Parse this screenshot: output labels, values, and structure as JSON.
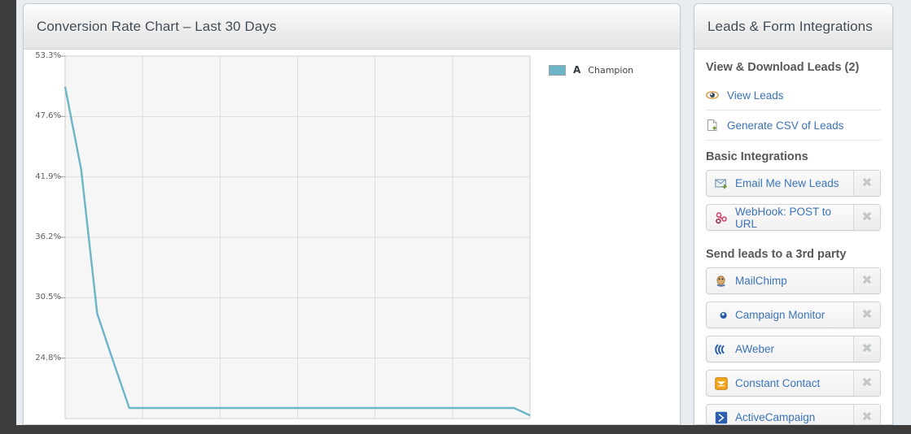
{
  "chart_panel": {
    "title": "Conversion Rate Chart – Last 30 Days",
    "legend": {
      "swatch_color": "#6bb5c6",
      "key": "A",
      "name": "Champion"
    }
  },
  "chart_data": {
    "type": "line",
    "title": "Conversion Rate Chart – Last 30 Days",
    "xlabel": "",
    "ylabel": "",
    "grid": true,
    "legend_position": "right",
    "ylim": [
      19.1,
      53.3
    ],
    "ytick_labels": [
      "53.3%",
      "47.6%",
      "41.9%",
      "36.2%",
      "30.5%",
      "24.8%"
    ],
    "ytick_values": [
      53.3,
      47.6,
      41.9,
      36.2,
      30.5,
      24.8
    ],
    "series": [
      {
        "name": "Champion",
        "key": "A",
        "color": "#6bb5c6",
        "x": [
          0,
          1,
          2,
          3,
          4,
          5,
          6,
          7,
          8,
          9,
          10,
          11,
          12,
          13,
          14,
          15,
          16,
          17,
          18,
          19,
          20,
          21,
          22,
          23,
          24,
          25,
          26,
          27,
          28,
          29
        ],
        "values": [
          50.4,
          42.6,
          29.0,
          24.5,
          20.1,
          20.1,
          20.1,
          20.1,
          20.1,
          20.1,
          20.1,
          20.1,
          20.1,
          20.1,
          20.1,
          20.1,
          20.1,
          20.1,
          20.1,
          20.1,
          20.1,
          20.1,
          20.1,
          20.1,
          20.1,
          20.1,
          20.1,
          20.1,
          20.1,
          19.4
        ]
      }
    ]
  },
  "sidebar": {
    "title": "Leads & Form Integrations",
    "download_section": {
      "heading": "View & Download Leads (2)",
      "links": [
        {
          "label": "View Leads",
          "icon": "eye-icon"
        },
        {
          "label": "Generate CSV of Leads",
          "icon": "csv-document-icon"
        }
      ]
    },
    "basic_section": {
      "heading": "Basic Integrations",
      "items": [
        {
          "label": "Email Me New Leads",
          "icon": "email-forward-icon",
          "remove": "✖"
        },
        {
          "label": "WebHook: POST to URL",
          "icon": "webhook-icon",
          "remove": "✖"
        }
      ]
    },
    "third_party_section": {
      "heading": "Send leads to a 3rd party",
      "items": [
        {
          "label": "MailChimp",
          "icon": "mailchimp-icon",
          "remove": "✖"
        },
        {
          "label": "Campaign Monitor",
          "icon": "campaign-monitor-icon",
          "remove": "✖"
        },
        {
          "label": "AWeber",
          "icon": "aweber-icon",
          "remove": "✖"
        },
        {
          "label": "Constant Contact",
          "icon": "constant-contact-icon",
          "remove": "✖"
        },
        {
          "label": "ActiveCampaign",
          "icon": "activecampaign-icon",
          "remove": "✖"
        }
      ]
    }
  },
  "colors": {
    "link": "#3b73b9",
    "series": "#6bb5c6",
    "page_background": "#3d3d3d"
  }
}
